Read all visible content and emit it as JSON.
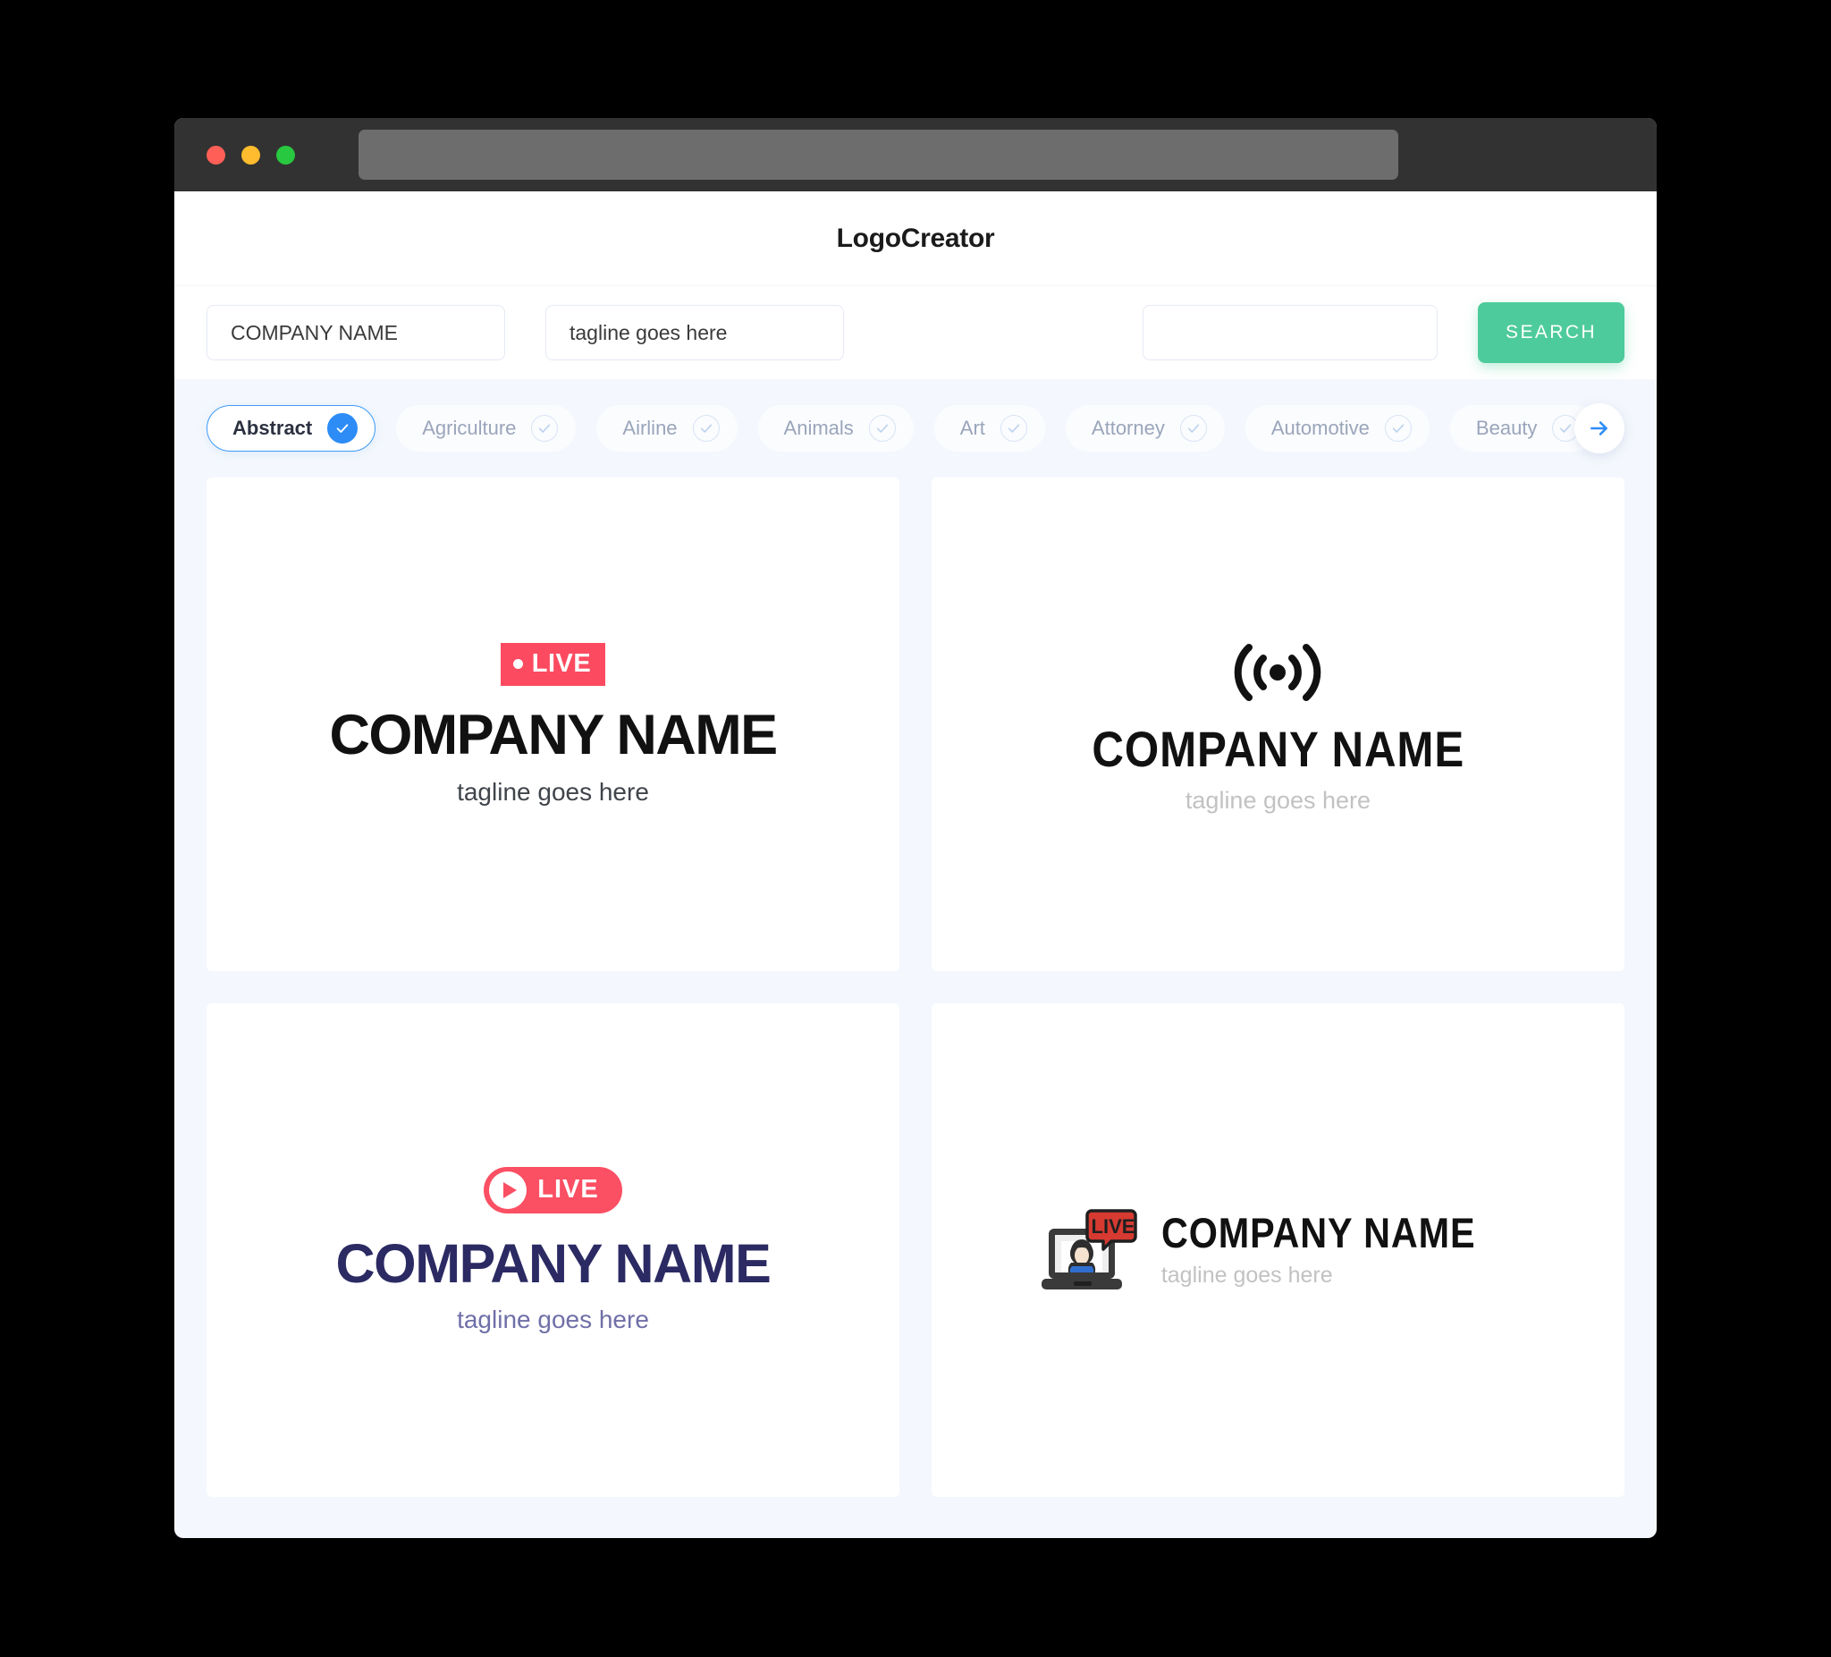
{
  "window": {
    "traffic_lights": [
      {
        "name": "close",
        "color": "#ff5f57"
      },
      {
        "name": "minimize",
        "color": "#febc2e"
      },
      {
        "name": "maximize",
        "color": "#28c840"
      }
    ],
    "url_bar_value": ""
  },
  "header": {
    "app_title": "LogoCreator"
  },
  "search": {
    "company_value": "COMPANY NAME",
    "company_placeholder": "COMPANY NAME",
    "tagline_value": "tagline goes here",
    "tagline_placeholder": "tagline goes here",
    "extra_value": "",
    "extra_placeholder": "",
    "search_label": "SEARCH",
    "search_color": "#4ecb9c"
  },
  "filters": {
    "next_arrow_icon": "arrow-right-icon",
    "accent_color": "#2d8cf5",
    "chips": [
      {
        "label": "Abstract",
        "selected": true
      },
      {
        "label": "Agriculture",
        "selected": false
      },
      {
        "label": "Airline",
        "selected": false
      },
      {
        "label": "Animals",
        "selected": false
      },
      {
        "label": "Art",
        "selected": false
      },
      {
        "label": "Attorney",
        "selected": false
      },
      {
        "label": "Automotive",
        "selected": false
      },
      {
        "label": "Beauty",
        "selected": false
      }
    ]
  },
  "results": [
    {
      "id": "logo-card-1",
      "badge_icon": "live-badge-flat-icon",
      "badge_dot": "",
      "badge_text": "LIVE",
      "badge_color": "#fc4b60",
      "company_name": "COMPANY NAME",
      "tagline": "tagline goes here",
      "name_color": "#111111",
      "tagline_color": "#40444b"
    },
    {
      "id": "logo-card-2",
      "badge_icon": "broadcast-signal-icon",
      "company_name": "COMPANY NAME",
      "tagline": "tagline goes here",
      "name_color": "#111111",
      "tagline_color": "#c2c2c2"
    },
    {
      "id": "logo-card-3",
      "badge_icon": "live-play-pill-icon",
      "badge_text": "LIVE",
      "badge_color": "#fb4f63",
      "company_name": "COMPANY NAME",
      "tagline": "tagline goes here",
      "name_color": "#2b2a63",
      "tagline_color": "#6f6fa8"
    },
    {
      "id": "logo-card-4",
      "badge_icon": "laptop-live-streamer-icon",
      "badge_text": "LIVE",
      "company_name": "COMPANY NAME",
      "tagline": "tagline goes here",
      "name_color": "#111111",
      "tagline_color": "#c2c2c2"
    }
  ]
}
